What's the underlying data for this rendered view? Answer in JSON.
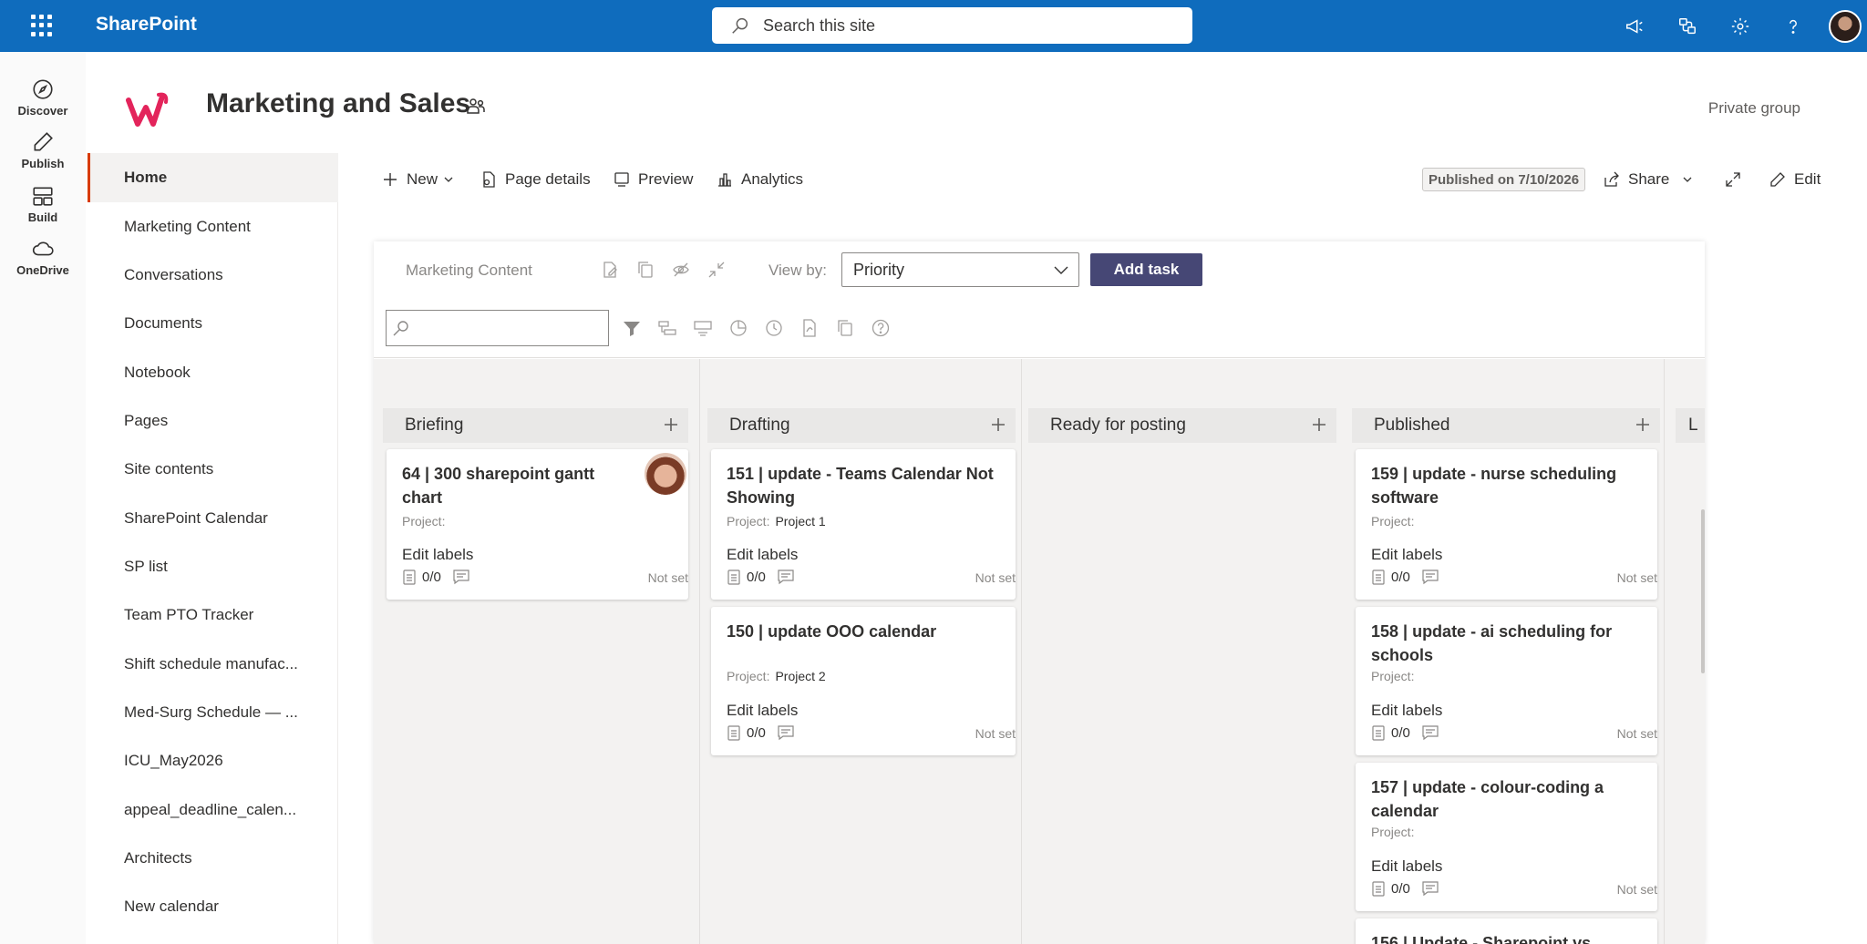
{
  "suite": {
    "brand": "SharePoint",
    "search_placeholder": "Search this site"
  },
  "appbar": {
    "items": [
      {
        "label": "Discover",
        "icon": "compass-icon"
      },
      {
        "label": "Publish",
        "icon": "pen-icon"
      },
      {
        "label": "Build",
        "icon": "layout-icon"
      },
      {
        "label": "OneDrive",
        "icon": "cloud-icon"
      }
    ]
  },
  "site": {
    "title": "Marketing and Sales",
    "group_label": "Private group"
  },
  "nav": {
    "items": [
      {
        "label": "Home",
        "active": true
      },
      {
        "label": "Marketing Content"
      },
      {
        "label": "Conversations"
      },
      {
        "label": "Documents"
      },
      {
        "label": "Notebook"
      },
      {
        "label": "Pages"
      },
      {
        "label": "Site contents"
      },
      {
        "label": "SharePoint Calendar"
      },
      {
        "label": "SP list"
      },
      {
        "label": "Team PTO Tracker"
      },
      {
        "label": "Shift schedule manufac..."
      },
      {
        "label": "Med-Surg Schedule — ..."
      },
      {
        "label": "ICU_May2026"
      },
      {
        "label": "appeal_deadline_calen..."
      },
      {
        "label": "Architects"
      },
      {
        "label": "New calendar"
      }
    ]
  },
  "commandbar": {
    "new": "New",
    "page_details": "Page details",
    "preview": "Preview",
    "analytics": "Analytics",
    "published": "Published on 7/10/2026",
    "share": "Share",
    "edit": "Edit"
  },
  "webpart": {
    "title": "Marketing Content",
    "viewby_label": "View by:",
    "viewby_value": "Priority",
    "add_task": "Add task",
    "buckets": [
      {
        "name": "Briefing",
        "cards": [
          {
            "title": "64 | 300 sharepoint gantt chart",
            "project_label": "Project:",
            "project": "",
            "labels": "Edit labels",
            "checklist": "0/0",
            "due": "Not set",
            "has_avatar": true
          }
        ]
      },
      {
        "name": "Drafting",
        "cards": [
          {
            "title": "151 | update - Teams Calendar Not Showing",
            "project_label": "Project:",
            "project": "Project 1",
            "labels": "Edit labels",
            "checklist": "0/0",
            "due": "Not set"
          },
          {
            "title": "150 | update OOO calendar",
            "project_label": "Project:",
            "project": "Project 2",
            "labels": "Edit labels",
            "checklist": "0/0",
            "due": "Not set"
          }
        ]
      },
      {
        "name": "Ready for posting",
        "cards": []
      },
      {
        "name": "Published",
        "cards": [
          {
            "title": "159 | update - nurse scheduling software",
            "project_label": "Project:",
            "project": "",
            "labels": "Edit labels",
            "checklist": "0/0",
            "due": "Not set"
          },
          {
            "title": "158 | update - ai scheduling for schools",
            "project_label": "Project:",
            "project": "",
            "labels": "Edit labels",
            "checklist": "0/0",
            "due": "Not set"
          },
          {
            "title": "157 | update - colour-coding a calendar",
            "project_label": "Project:",
            "project": "",
            "labels": "Edit labels",
            "checklist": "0/0",
            "due": "Not set"
          },
          {
            "title": "156 | Update - Sharepoint vs",
            "project_label": "",
            "project": "",
            "labels": "",
            "checklist": "",
            "due": ""
          }
        ]
      },
      {
        "name": "L",
        "cards": []
      }
    ]
  },
  "colors": {
    "suitebar": "#0f6cbd",
    "accent_nav": "#d83b01",
    "add_task": "#464775",
    "logo": "#e3245b"
  }
}
